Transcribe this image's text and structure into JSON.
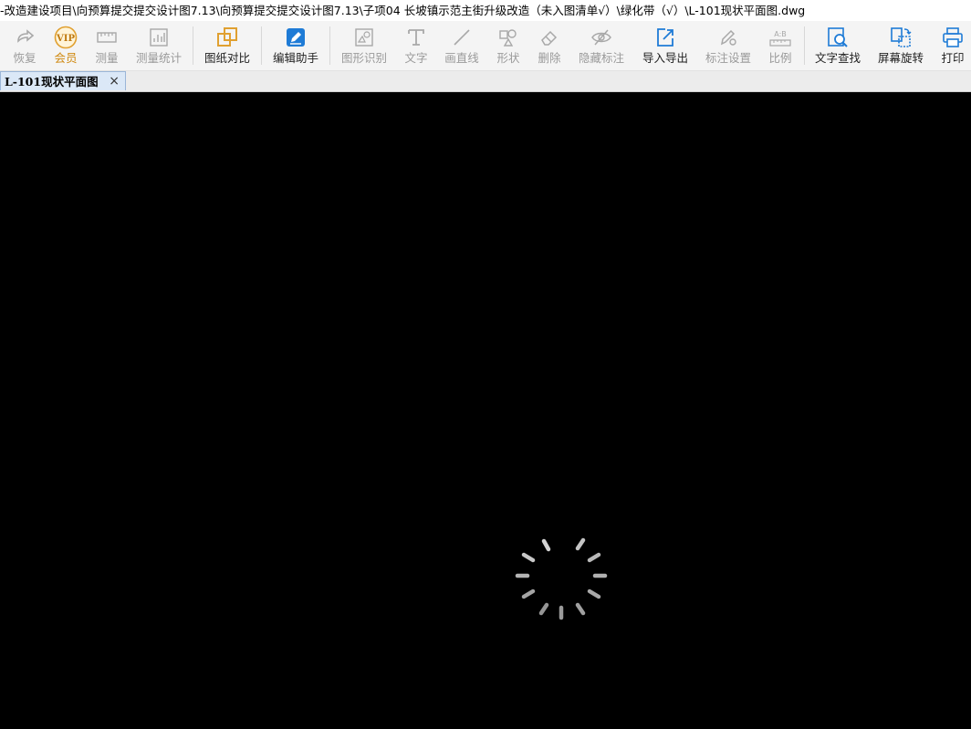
{
  "window": {
    "title": "-改造建设项目\\向预算提交提交设计图7.13\\向预算提交提交设计图7.13\\子项04 长坡镇示范主街升级改造（未入图清单√）\\绿化带（√）\\L-101现状平面图.dwg"
  },
  "toolbar": {
    "undo": {
      "label": "恢复",
      "icon": "undo-arrow-icon"
    },
    "vip": {
      "label": "会员",
      "icon": "vip-badge-icon",
      "badge": "VIP"
    },
    "measure": {
      "label": "测量",
      "icon": "ruler-icon"
    },
    "measure_stats": {
      "label": "测量统计",
      "icon": "stats-icon"
    },
    "compare": {
      "label": "图纸对比",
      "icon": "overlap-squares-icon"
    },
    "edit_assistant": {
      "label": "编辑助手",
      "icon": "edit-assistant-icon"
    },
    "shape_recognition": {
      "label": "图形识别",
      "icon": "shape-recognition-icon"
    },
    "text": {
      "label": "文字",
      "icon": "text-t-icon"
    },
    "line": {
      "label": "画直线",
      "icon": "line-icon"
    },
    "shape": {
      "label": "形状",
      "icon": "shapes-icon"
    },
    "delete": {
      "label": "删除",
      "icon": "eraser-icon"
    },
    "hide_marks": {
      "label": "隐藏标注",
      "icon": "eye-slash-icon"
    },
    "import_export": {
      "label": "导入导出",
      "icon": "import-export-icon"
    },
    "mark_settings": {
      "label": "标注设置",
      "icon": "pen-gear-icon"
    },
    "scale": {
      "label": "比例",
      "icon": "scale-ab-icon",
      "glyph": "A:B"
    },
    "text_search": {
      "label": "文字查找",
      "icon": "text-search-icon"
    },
    "rotate_screen": {
      "label": "屏幕旋转",
      "icon": "rotate-screen-icon"
    },
    "print": {
      "label": "打印",
      "icon": "printer-icon"
    }
  },
  "tabs": [
    {
      "label": "L-101现状平面图",
      "close": "×",
      "active": true
    }
  ],
  "colors": {
    "accent_blue": "#1e7bd6",
    "accent_gold": "#e0a030",
    "disabled_gray": "#a8a8a8",
    "canvas": "#000000"
  },
  "canvas": {
    "state": "loading",
    "spinner_icon": "loading-spinner-icon"
  }
}
